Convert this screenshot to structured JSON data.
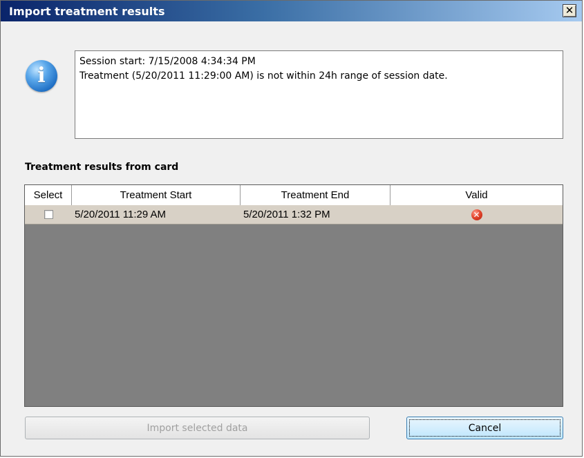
{
  "window": {
    "title": "Import treatment results",
    "close_glyph": "✕"
  },
  "message": {
    "icon": "info-icon",
    "icon_glyph": "i",
    "lines": [
      "Session start: 7/15/2008 4:34:34 PM",
      "Treatment (5/20/2011 11:29:00 AM) is not within 24h range of session date."
    ]
  },
  "section": {
    "label": "Treatment results from card"
  },
  "table": {
    "columns": [
      "Select",
      "Treatment Start",
      "Treatment End",
      "Valid"
    ],
    "rows": [
      {
        "selected": false,
        "start": "5/20/2011 11:29 AM",
        "end": "5/20/2011 1:32 PM",
        "valid": false,
        "valid_icon": "error-icon"
      }
    ]
  },
  "buttons": {
    "import_label": "Import selected data",
    "import_enabled": false,
    "cancel_label": "Cancel"
  },
  "colors": {
    "grid_background": "#808080",
    "row_background": "#d8d1c6",
    "invalid_icon": "#e0432b"
  }
}
